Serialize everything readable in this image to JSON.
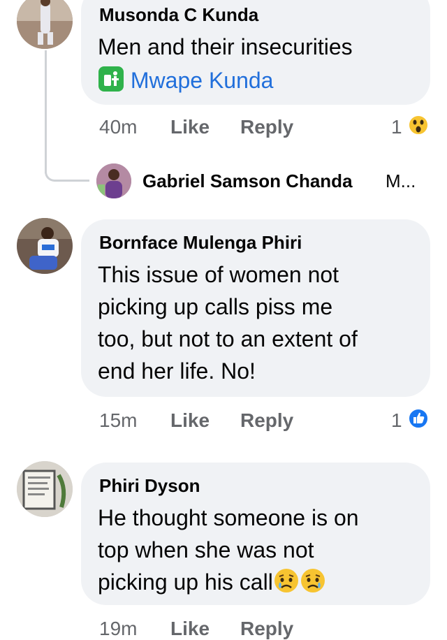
{
  "comments": [
    {
      "author": "Musonda C Kunda",
      "text": "Men and their insecurities",
      "mention": "Mwape Kunda",
      "time": "40m",
      "like_label": "Like",
      "reply_label": "Reply",
      "reaction_count": "1",
      "reaction_icon": "wow-reaction-icon"
    },
    {
      "author": "Bornface Mulenga Phiri",
      "lines": [
        "This issue of women not",
        "picking up calls piss me",
        "too, but not to an extent of",
        "end her life. No!"
      ],
      "time": "15m",
      "like_label": "Like",
      "reply_label": "Reply",
      "reaction_count": "1",
      "reaction_icon": "like-reaction-icon"
    },
    {
      "author": "Phiri Dyson",
      "lines": [
        "He thought someone is on",
        "top when she was not",
        "picking up his call"
      ],
      "time": "19m",
      "like_label": "Like",
      "reply_label": "Reply"
    }
  ],
  "reply_preview": {
    "author": "Gabriel Samson Chanda",
    "snippet": "M..."
  },
  "colors": {
    "bubble": "#f0f2f5",
    "meta": "#65676b",
    "mention": "#216fdb",
    "like_blue": "#1877f2",
    "emoji_yellow": "#f7c431"
  }
}
